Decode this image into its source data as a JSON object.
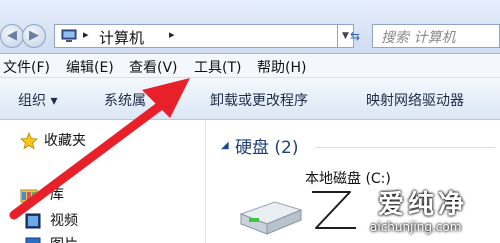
{
  "address_bar": {
    "back_icon": "arrow-left-icon",
    "forward_icon": "arrow-right-icon",
    "location_icon": "computer-icon",
    "path_separator": "▸",
    "path_label": "计算机",
    "trailing_separator": "▸",
    "refresh_icon": "refresh-icon",
    "search_placeholder": "搜索 计算机"
  },
  "menu": {
    "items": [
      "文件(F)",
      "编辑(E)",
      "查看(V)",
      "工具(T)",
      "帮助(H)"
    ]
  },
  "toolbar": {
    "items": [
      "组织 ▾",
      "系统属",
      "卸载或更改程序",
      "映射网络驱动器"
    ]
  },
  "nav": {
    "favorites": "收藏夹",
    "libraries": "库",
    "videos": "视频",
    "pictures": "图片"
  },
  "content": {
    "group_title": "硬盘 (2)",
    "drive_label": "本地磁盘 (C:)"
  },
  "watermark": {
    "title": "爱纯净",
    "url": "aichunjing.com"
  },
  "colors": {
    "arrow": "#e8202a",
    "accent": "#1e3f7a",
    "chrome": "#cfdcf0"
  }
}
